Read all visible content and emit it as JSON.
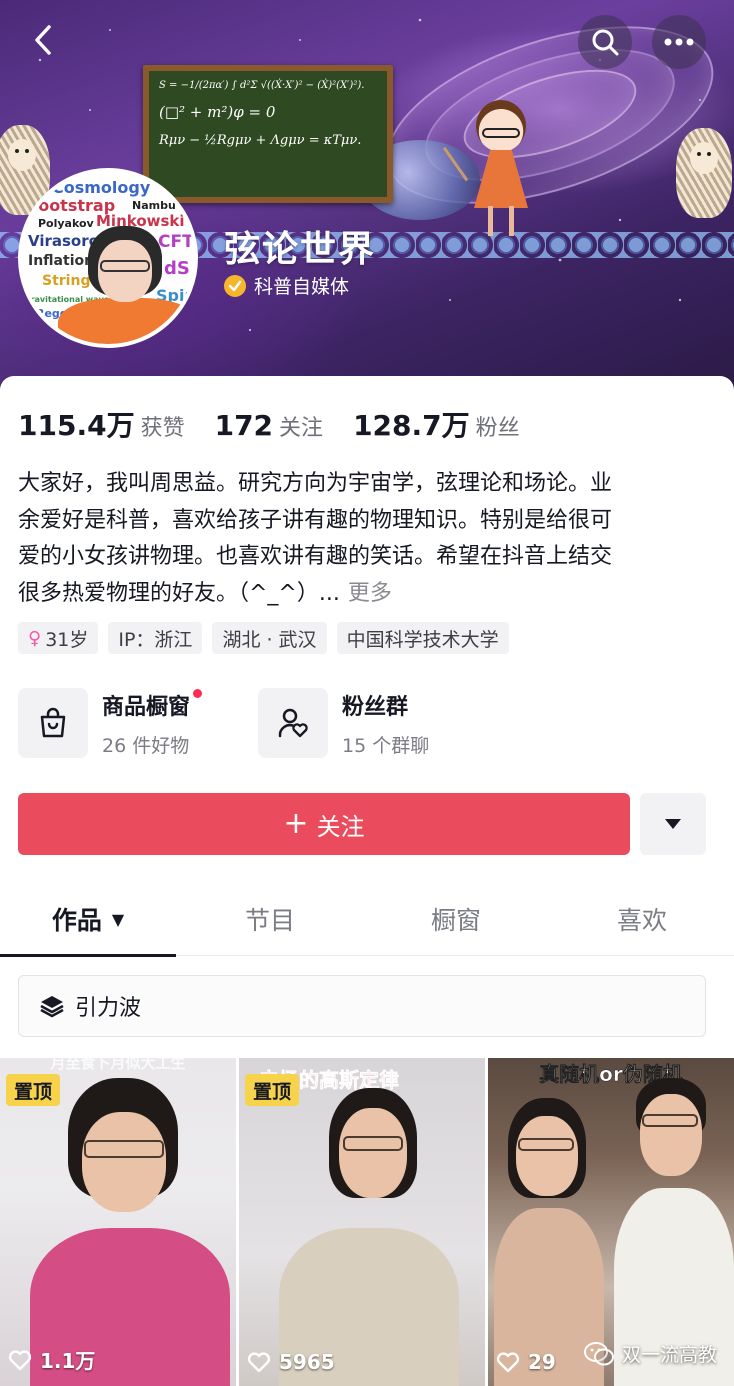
{
  "header": {
    "profile_name": "弦论世界",
    "verification_label": "科普自媒体"
  },
  "banner": {
    "chalkboard_equations": [
      "S = −1/(2πα′) ∫ d²Σ √((Ẋ·X′)² − (Ẋ)²(X′)²).",
      "(□² + m²)φ = 0",
      "Rμν − ½Rgμν + Λgμν = κTμν."
    ]
  },
  "avatar": {
    "wordcloud_words": [
      "Cosmology",
      "Ad",
      "Bootstrap",
      "Nambu Go",
      "Polyakov",
      "Minkowski",
      "Virasoro",
      "CFT",
      "Inflation",
      "dS",
      "String",
      "Spir",
      "Gravitational wave",
      "Regge"
    ]
  },
  "stats": [
    {
      "value": "115.4万",
      "label": "获赞"
    },
    {
      "value": "172",
      "label": "关注"
    },
    {
      "value": "128.7万",
      "label": "粉丝"
    }
  ],
  "bio": {
    "lines": [
      "大家好，我叫周思益。研究方向为宇宙学，弦理论和场论。业",
      "余爱好是科普，喜欢给孩子讲有趣的物理知识。特别是给很可",
      "爱的小女孩讲物理。也喜欢讲有趣的笑话。希望在抖音上结交",
      "很多热爱物理的好友。（^_^）..."
    ],
    "more_label": "更多"
  },
  "tags": {
    "age": "31岁",
    "ip": "IP：浙江",
    "location": "湖北 · 武汉",
    "school": "中国科学技术大学"
  },
  "features": {
    "shop": {
      "title": "商品橱窗",
      "subtitle": "26 件好物"
    },
    "fans": {
      "title": "粉丝群",
      "subtitle": "15 个群聊"
    }
  },
  "follow": {
    "label": "关注"
  },
  "tabs": [
    {
      "label": "作品"
    },
    {
      "label": "节目"
    },
    {
      "label": "橱窗"
    },
    {
      "label": "喜欢"
    }
  ],
  "collection": {
    "label": "引力波"
  },
  "videos": [
    {
      "caption": "月至食卜月似大工生",
      "badge": "置顶",
      "likes": "1.1万"
    },
    {
      "caption": "电场的高斯定律",
      "badge": "置顶",
      "likes": "5965"
    },
    {
      "caption": "真随机or伪随机",
      "badge": "",
      "likes": "29"
    }
  ],
  "watermark": {
    "label": "双一流高教"
  },
  "colors": {
    "accent": "#ea4c5d",
    "badge_yellow": "#f6d34a",
    "verify_gold": "#f7b52c",
    "female_pink": "#f25aa7",
    "red_dot": "#fe2c55"
  }
}
